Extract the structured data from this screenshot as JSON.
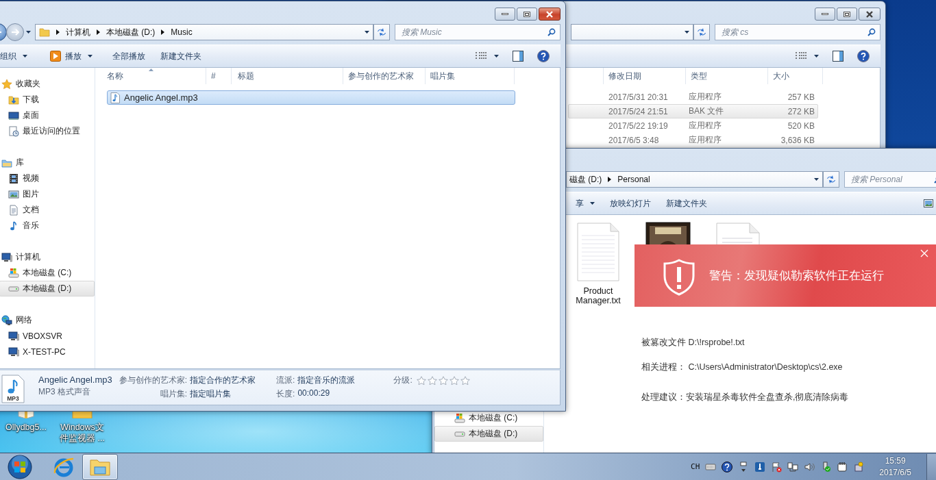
{
  "desktop": {
    "icons": [
      {
        "label": "Ollydbg5...",
        "kind": "book"
      },
      {
        "label": "Windows文件监视器 ...",
        "kind": "folder"
      }
    ]
  },
  "back_window": {
    "search": {
      "placeholder": "搜索 cs"
    },
    "columns": [
      "修改日期",
      "类型",
      "大小"
    ],
    "rows": [
      {
        "modified": "2017/5/31 20:31",
        "type": "应用程序",
        "size": "257 KB",
        "selected": false,
        "hovered": false
      },
      {
        "modified": "2017/5/24 21:51",
        "type": "BAK 文件",
        "size": "272 KB",
        "selected": false,
        "hovered": true
      },
      {
        "modified": "2017/5/22 19:19",
        "type": "应用程序",
        "size": "520 KB",
        "selected": false,
        "hovered": false
      },
      {
        "modified": "2017/6/5 3:48",
        "type": "应用程序",
        "size": "3,636 KB",
        "selected": false,
        "hovered": false
      }
    ]
  },
  "personal_window": {
    "address": {
      "cut": true,
      "crumbs": [
        "磁盘 (D:)",
        "Personal"
      ]
    },
    "search": {
      "placeholder": "搜索 Personal"
    },
    "toolbar": [
      {
        "label": "享",
        "kind": "menu"
      },
      {
        "label": "放映幻灯片",
        "kind": "plain"
      },
      {
        "label": "新建文件夹",
        "kind": "plain"
      }
    ],
    "nav": [
      {
        "label": "本地磁盘 (C:)",
        "kind": "system-drive",
        "selected": false
      },
      {
        "label": "本地磁盘 (D:)",
        "kind": "drive",
        "selected": true
      }
    ],
    "files": [
      {
        "name": "Product Manager.txt",
        "kind": "text"
      },
      {
        "kind": "image"
      },
      {
        "kind": "document"
      }
    ]
  },
  "alert": {
    "title": "警告：发现疑似勒索软件正在运行",
    "lines": [
      "被篡改文件 D:\\!rsprobe!.txt",
      "相关进程： C:\\Users\\Administrator\\Desktop\\cs\\2.exe",
      "处理建议：安装瑞星杀毒软件全盘查杀,彻底清除病毒"
    ]
  },
  "music_window": {
    "address": {
      "cut": false,
      "crumbs": [
        "计算机",
        "本地磁盘 (D:)",
        "Music"
      ]
    },
    "search": {
      "placeholder": "搜索 Music"
    },
    "toolbar": [
      {
        "label": "组织",
        "kind": "menu"
      },
      {
        "label": "播放",
        "kind": "play"
      },
      {
        "label": "全部播放",
        "kind": "plain"
      },
      {
        "label": "新建文件夹",
        "kind": "plain"
      }
    ],
    "nav": [
      {
        "label": "收藏夹",
        "kind": "favorites",
        "selected": false,
        "children": [
          {
            "label": "下载",
            "kind": "downloads",
            "selected": false
          },
          {
            "label": "桌面",
            "kind": "desktop",
            "selected": false
          },
          {
            "label": "最近访问的位置",
            "kind": "recent",
            "selected": false
          }
        ]
      },
      {
        "label": "库",
        "kind": "libraries",
        "selected": false,
        "children": [
          {
            "label": "视频",
            "kind": "videos",
            "selected": false
          },
          {
            "label": "图片",
            "kind": "pictures",
            "selected": false
          },
          {
            "label": "文档",
            "kind": "documents",
            "selected": false
          },
          {
            "label": "音乐",
            "kind": "music",
            "selected": false
          }
        ]
      },
      {
        "label": "计算机",
        "kind": "computer",
        "selected": false,
        "children": [
          {
            "label": "本地磁盘 (C:)",
            "kind": "system-drive",
            "selected": false
          },
          {
            "label": "本地磁盘 (D:)",
            "kind": "drive",
            "selected": true
          }
        ]
      },
      {
        "label": "网络",
        "kind": "network",
        "selected": false,
        "children": [
          {
            "label": "VBOXSVR",
            "kind": "network-pc",
            "selected": false
          },
          {
            "label": "X-TEST-PC",
            "kind": "network-pc",
            "selected": false
          }
        ]
      }
    ],
    "columns": [
      {
        "label": "名称",
        "sorted": true
      },
      {
        "label": "#",
        "sorted": false
      },
      {
        "label": "标题",
        "sorted": false
      },
      {
        "label": "参与创作的艺术家",
        "sorted": false
      },
      {
        "label": "唱片集",
        "sorted": false
      }
    ],
    "files": [
      {
        "name": "Angelic Angel.mp3",
        "selected": true
      }
    ],
    "details": {
      "icon_label": "MP3",
      "name": "Angelic Angel.mp3",
      "type": "MP3 格式声音",
      "properties": [
        {
          "label": "参与创作的艺术家:",
          "value": "指定合作的艺术家"
        },
        {
          "label": "唱片集:",
          "value": "指定唱片集"
        },
        {
          "label": "流派:",
          "value": "指定音乐的流派"
        },
        {
          "label": "长度:",
          "value": "00:00:29"
        }
      ],
      "rating": {
        "label": "分级:",
        "stars": 0
      }
    }
  },
  "taskbar": {
    "buttons": [
      {
        "kind": "start",
        "active": false
      },
      {
        "kind": "browser",
        "active": false
      },
      {
        "kind": "explorer",
        "active": true
      }
    ],
    "language": "CH",
    "time": "15:59",
    "date": "2017/6/5"
  }
}
